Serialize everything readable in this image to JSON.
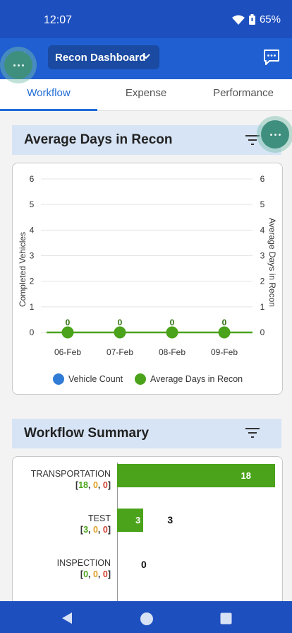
{
  "status": {
    "time": "12:07",
    "battery": "65%"
  },
  "header": {
    "title": "Recon Dashboard",
    "menu_icon": "chat-icon",
    "back_icon": "chevron-left-icon"
  },
  "tabs": [
    {
      "label": "Workflow",
      "active": true
    },
    {
      "label": "Expense",
      "active": false
    },
    {
      "label": "Performance",
      "active": false
    }
  ],
  "avg_days": {
    "title": "Average Days in Recon",
    "filter_icon": "filter-icon"
  },
  "chart_data": {
    "type": "line",
    "x": [
      "06-Feb",
      "07-Feb",
      "08-Feb",
      "09-Feb"
    ],
    "yleft_label": "Completed Vehicles",
    "yright_label": "Average Days in Recon",
    "ylim": [
      0,
      6
    ],
    "yticks": [
      "0",
      "1",
      "2",
      "3",
      "4",
      "5",
      "6"
    ],
    "series": [
      {
        "name": "Vehicle Count",
        "values": [
          0,
          0,
          0,
          0
        ],
        "color": "#2f7bd6"
      },
      {
        "name": "Average Days in Recon",
        "values": [
          0,
          0,
          0,
          0
        ],
        "color": "#4aa31a"
      }
    ],
    "data_labels": [
      "0",
      "0",
      "0",
      "0"
    ],
    "legend_position": "bottom"
  },
  "summary": {
    "title": "Workflow Summary",
    "rows": [
      {
        "label": "TRANSPORTATION",
        "counts": [
          "18",
          "0",
          "0"
        ],
        "value": 18,
        "value_label": "18"
      },
      {
        "label": "TEST",
        "counts": [
          "3",
          "0",
          "0"
        ],
        "value": 3,
        "value_label": "3"
      },
      {
        "label": "INSPECTION",
        "counts": [
          "0",
          "0",
          "0"
        ],
        "value": 0,
        "value_label": "0"
      }
    ],
    "count_colors": [
      "#4aa31a",
      "#e0a020",
      "#d04030"
    ]
  },
  "nav": {
    "back": "back-triangle-icon",
    "home": "home-circle-icon",
    "recents": "recents-square-icon"
  }
}
